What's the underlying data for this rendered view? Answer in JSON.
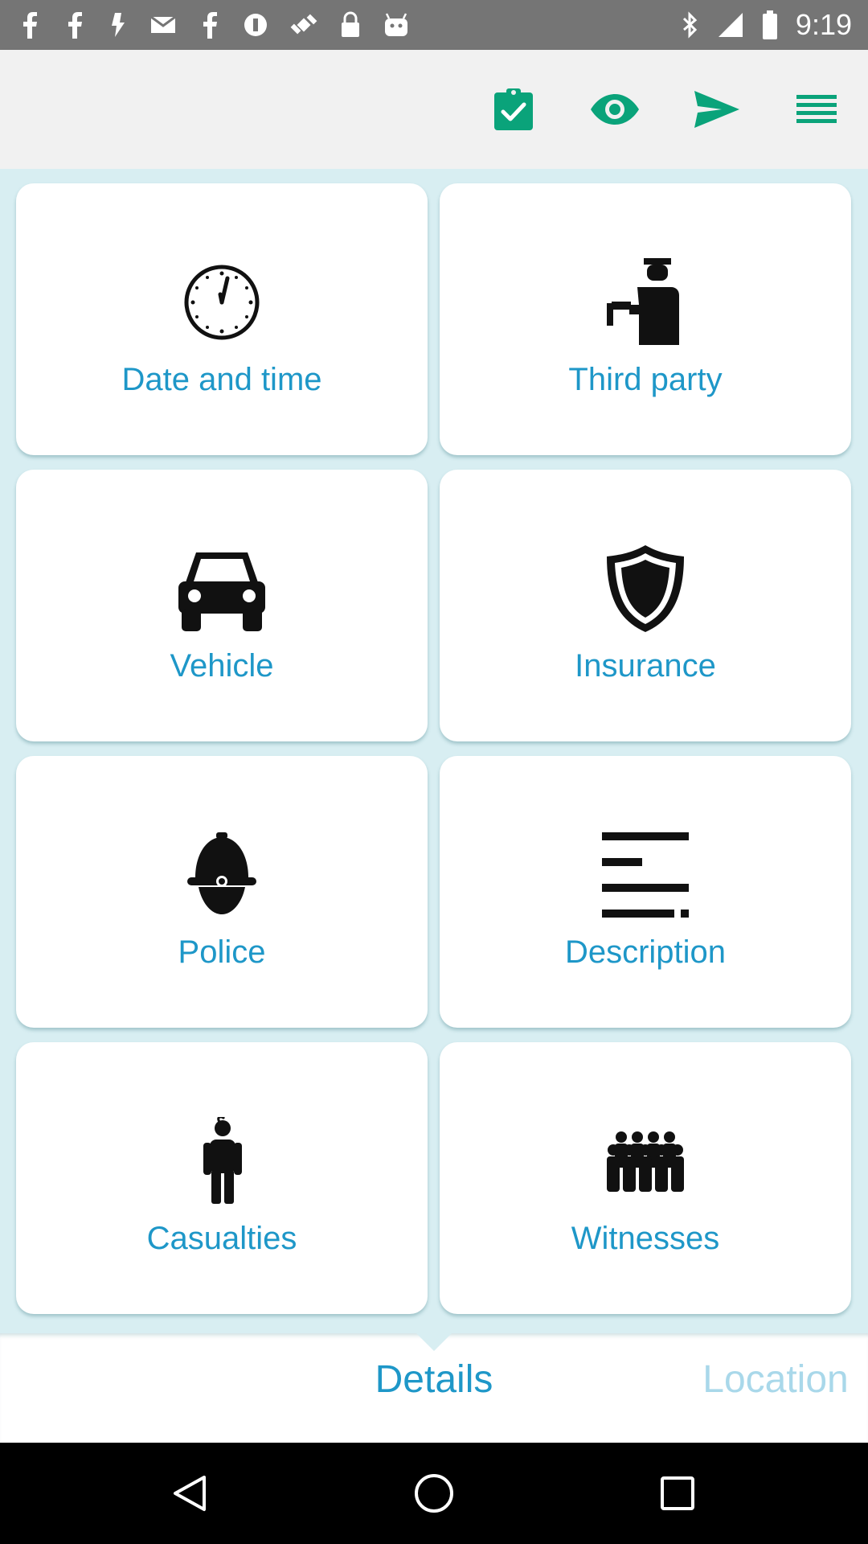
{
  "status_bar": {
    "time": "9:19",
    "left_icons": [
      "facebook-icon",
      "facebook-icon",
      "notification-icon",
      "email-icon",
      "facebook-icon",
      "circle-notification-icon",
      "fake-gps-icon",
      "lock-icon",
      "android-icon"
    ],
    "right_icons": [
      "bluetooth-icon",
      "signal-icon",
      "battery-icon"
    ]
  },
  "toolbar": {
    "icons": [
      "clipboard-check-icon",
      "eye-icon",
      "send-icon",
      "menu-icon"
    ],
    "accent": "#0aa37a"
  },
  "tiles": [
    {
      "label": "Date and time",
      "icon": "clock-icon"
    },
    {
      "label": "Third party",
      "icon": "person-with-sign-icon"
    },
    {
      "label": "Vehicle",
      "icon": "car-icon"
    },
    {
      "label": "Insurance",
      "icon": "shield-icon"
    },
    {
      "label": "Police",
      "icon": "police-helmet-icon"
    },
    {
      "label": "Description",
      "icon": "text-lines-icon"
    },
    {
      "label": "Casualties",
      "icon": "injured-person-icon"
    },
    {
      "label": "Witnesses",
      "icon": "group-icon"
    }
  ],
  "tabs": {
    "details": "Details",
    "location": "Location",
    "active": "Details"
  },
  "colors": {
    "label": "#1e97c8",
    "inactive_tab": "#a9d8ea",
    "grid_background": "#d8eef2",
    "status_bar": "#757575"
  }
}
